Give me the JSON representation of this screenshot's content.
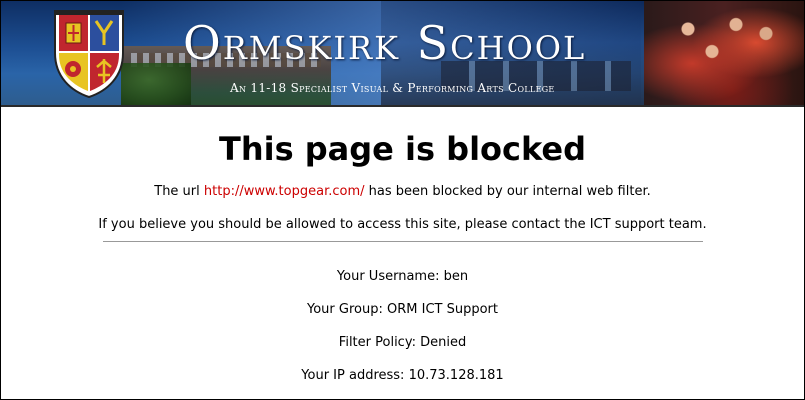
{
  "banner": {
    "school_name": "Ormskirk School",
    "tagline": "An 11-18 Specialist Visual & Performing Arts College"
  },
  "blocked": {
    "heading": "This page is blocked",
    "url_prefix": "The url ",
    "url": "http://www.topgear.com/",
    "url_suffix": " has been blocked by our internal web filter.",
    "contact_message": "If you believe you should be allowed to access this site, please contact the ICT support team."
  },
  "details": {
    "username": "Your Username: ben",
    "group": "Your Group: ORM ICT Support",
    "filter_policy": "Filter Policy: Denied",
    "ip_address": "Your IP address: 10.73.128.181"
  },
  "colors": {
    "link": "#cc0000",
    "banner_blue": "#1d4f93"
  },
  "icons": {
    "crest": "school-crest-icon"
  }
}
